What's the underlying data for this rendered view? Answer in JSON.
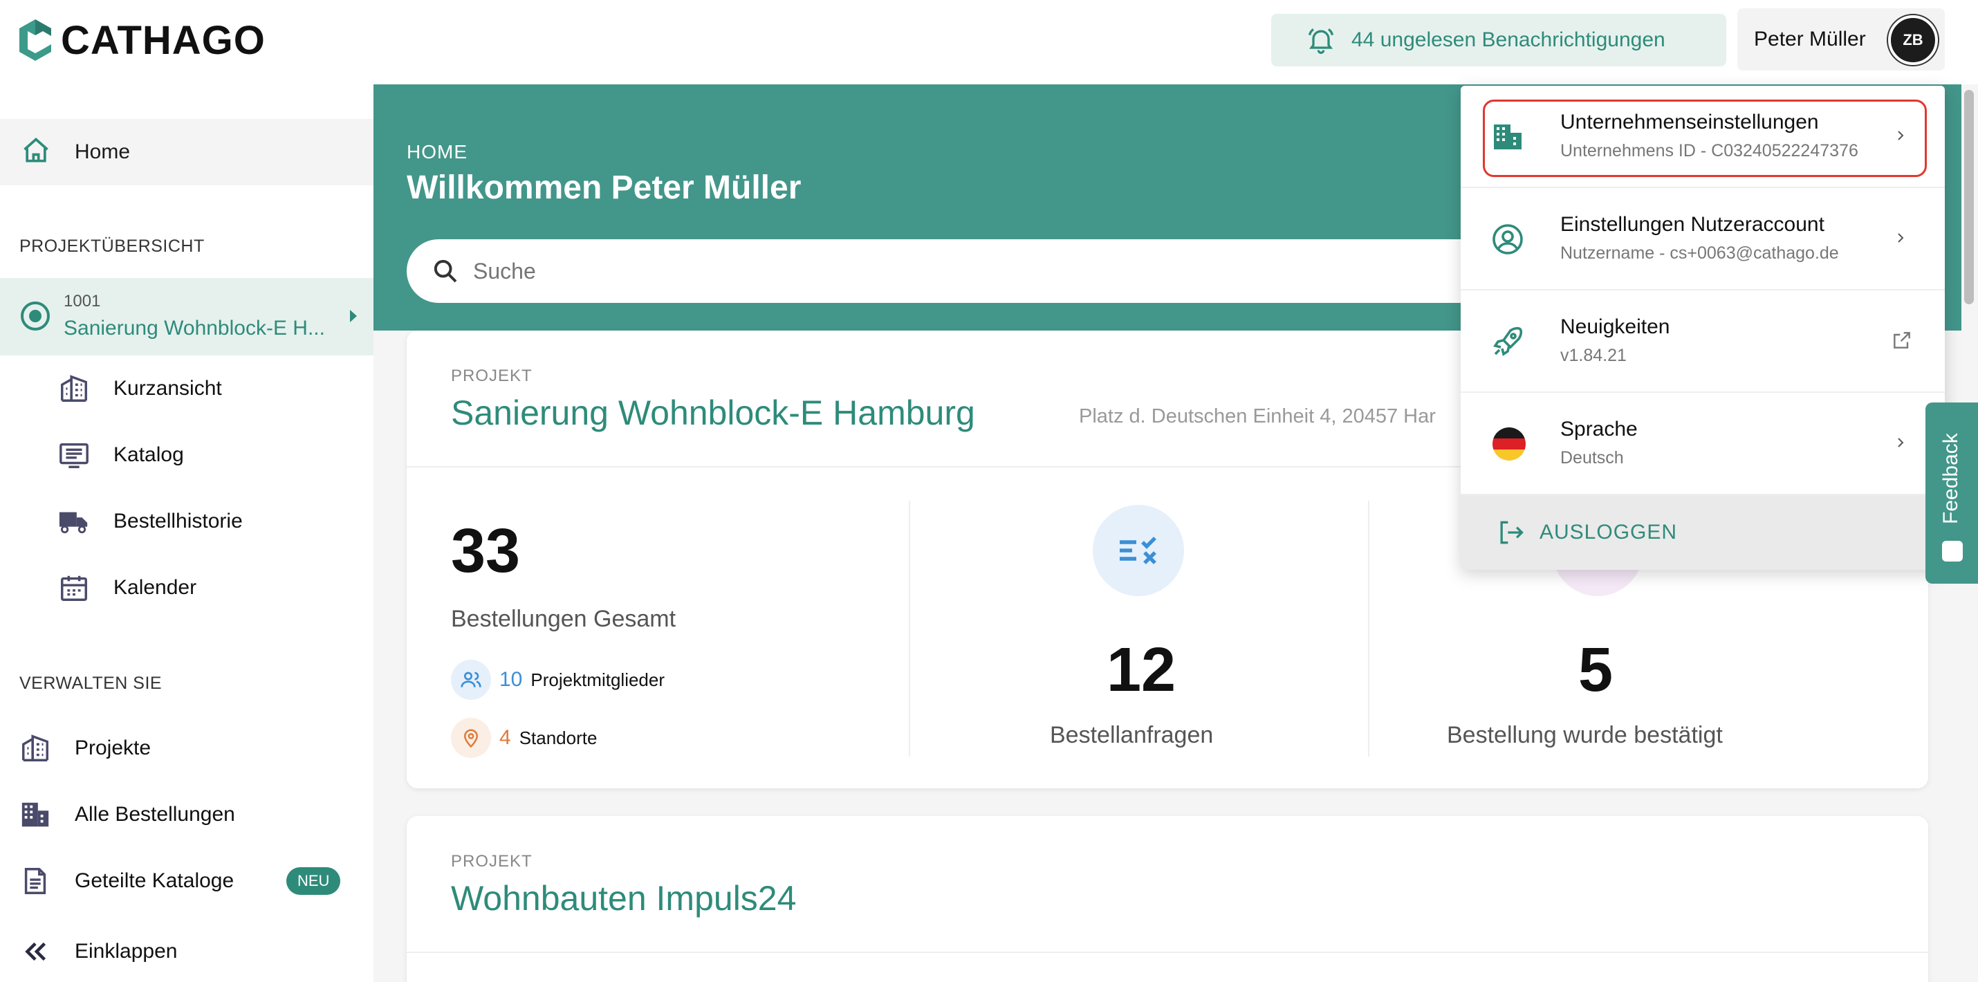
{
  "app": {
    "brand": "CATHAGO",
    "brand_color": "#2e8b7a"
  },
  "header": {
    "notifications_label": "44 ungelesen Benachrichtigungen",
    "user_name": "Peter Müller",
    "avatar_initials": "ZB"
  },
  "sidebar": {
    "home_label": "Home",
    "section_projects": "PROJEKTÜBERSICHT",
    "active_project": {
      "number": "1001",
      "name": "Sanierung Wohnblock-E H..."
    },
    "project_items": [
      {
        "label": "Kurzansicht",
        "icon": "building-icon"
      },
      {
        "label": "Katalog",
        "icon": "catalog-icon"
      },
      {
        "label": "Bestellhistorie",
        "icon": "truck-icon"
      },
      {
        "label": "Kalender",
        "icon": "calendar-icon"
      }
    ],
    "section_manage": "VERWALTEN SIE",
    "manage_items": [
      {
        "label": "Projekte",
        "icon": "building-icon"
      },
      {
        "label": "Alle Bestellungen",
        "icon": "office-building-icon"
      },
      {
        "label": "Geteilte Kataloge",
        "icon": "document-icon",
        "badge": "NEU"
      }
    ],
    "collapse_label": "Einklappen"
  },
  "main": {
    "breadcrumb": "HOME",
    "welcome": "Willkommen Peter Müller",
    "search_placeholder": "Suche",
    "projects": [
      {
        "label": "PROJEKT",
        "title": "Sanierung Wohnblock-E Hamburg",
        "address": "Platz d. Deutschen Einheit 4, 20457 Har",
        "total_orders": "33",
        "total_orders_label": "Bestellungen Gesamt",
        "members_count": "10",
        "members_label": "Projektmitglieder",
        "locations_count": "4",
        "locations_label": "Standorte",
        "requests_count": "12",
        "requests_label": "Bestellanfragen",
        "confirmed_count": "5",
        "confirmed_label": "Bestellung wurde bestätigt"
      },
      {
        "label": "PROJEKT",
        "title": "Wohnbauten Impuls24"
      }
    ]
  },
  "dropdown": {
    "items": [
      {
        "title": "Unternehmenseinstellungen",
        "subtitle": "Unternehmens ID - C03240522247376",
        "icon": "office-building-icon",
        "highlighted": true
      },
      {
        "title": "Einstellungen Nutzeraccount",
        "subtitle": "Nutzername - cs+0063@cathago.de",
        "icon": "user-circle-icon"
      },
      {
        "title": "Neuigkeiten",
        "subtitle": "v1.84.21",
        "icon": "rocket-icon"
      },
      {
        "title": "Sprache",
        "subtitle": "Deutsch",
        "icon": "german-flag-icon"
      }
    ],
    "logout_label": "AUSLOGGEN"
  },
  "feedback_label": "Feedback"
}
